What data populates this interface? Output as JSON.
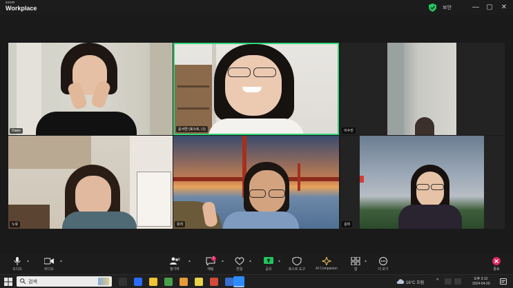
{
  "app": {
    "brand_small": "zoom",
    "brand_name": "Workplace",
    "security_label": "보안",
    "window_controls": [
      "minimize-icon",
      "maximize-icon",
      "close-icon"
    ]
  },
  "participants": [
    {
      "name": "Diane",
      "video_on": true
    },
    {
      "name": "윤서연 (호스트, 나)",
      "video_on": true,
      "active_speaker": true
    },
    {
      "name": "이수진",
      "video_on": true
    },
    {
      "name": "노유",
      "video_on": true
    },
    {
      "name": "유리",
      "video_on": true
    },
    {
      "name": "김미",
      "video_on": true
    }
  ],
  "toolbar": {
    "mic": {
      "label": "오디오",
      "icon": "microphone-icon"
    },
    "video": {
      "label": "비디오",
      "icon": "video-camera-icon"
    },
    "participants": {
      "label": "참가자",
      "count": "6",
      "icon": "people-icon"
    },
    "chat": {
      "label": "채팅",
      "badge": "1",
      "icon": "chat-icon"
    },
    "react": {
      "label": "반응",
      "icon": "heart-icon"
    },
    "share": {
      "label": "공유",
      "icon": "share-screen-icon"
    },
    "host_tools": {
      "label": "호스트 도구",
      "icon": "shield-icon"
    },
    "ai": {
      "label": "AI Companion",
      "icon": "sparkle-icon"
    },
    "apps": {
      "label": "앱",
      "icon": "apps-icon"
    },
    "more": {
      "label": "더 보기",
      "icon": "more-icon"
    },
    "end": {
      "label": "종료",
      "icon": "end-call-icon"
    }
  },
  "taskbar": {
    "search_placeholder": "검색",
    "weather": "16°C 흐림",
    "time": "오후 3:12",
    "date": "2024-04-20",
    "colors": {
      "green": "#2fd57a",
      "end_red": "#e0245e",
      "share_green": "#22c55e"
    }
  }
}
